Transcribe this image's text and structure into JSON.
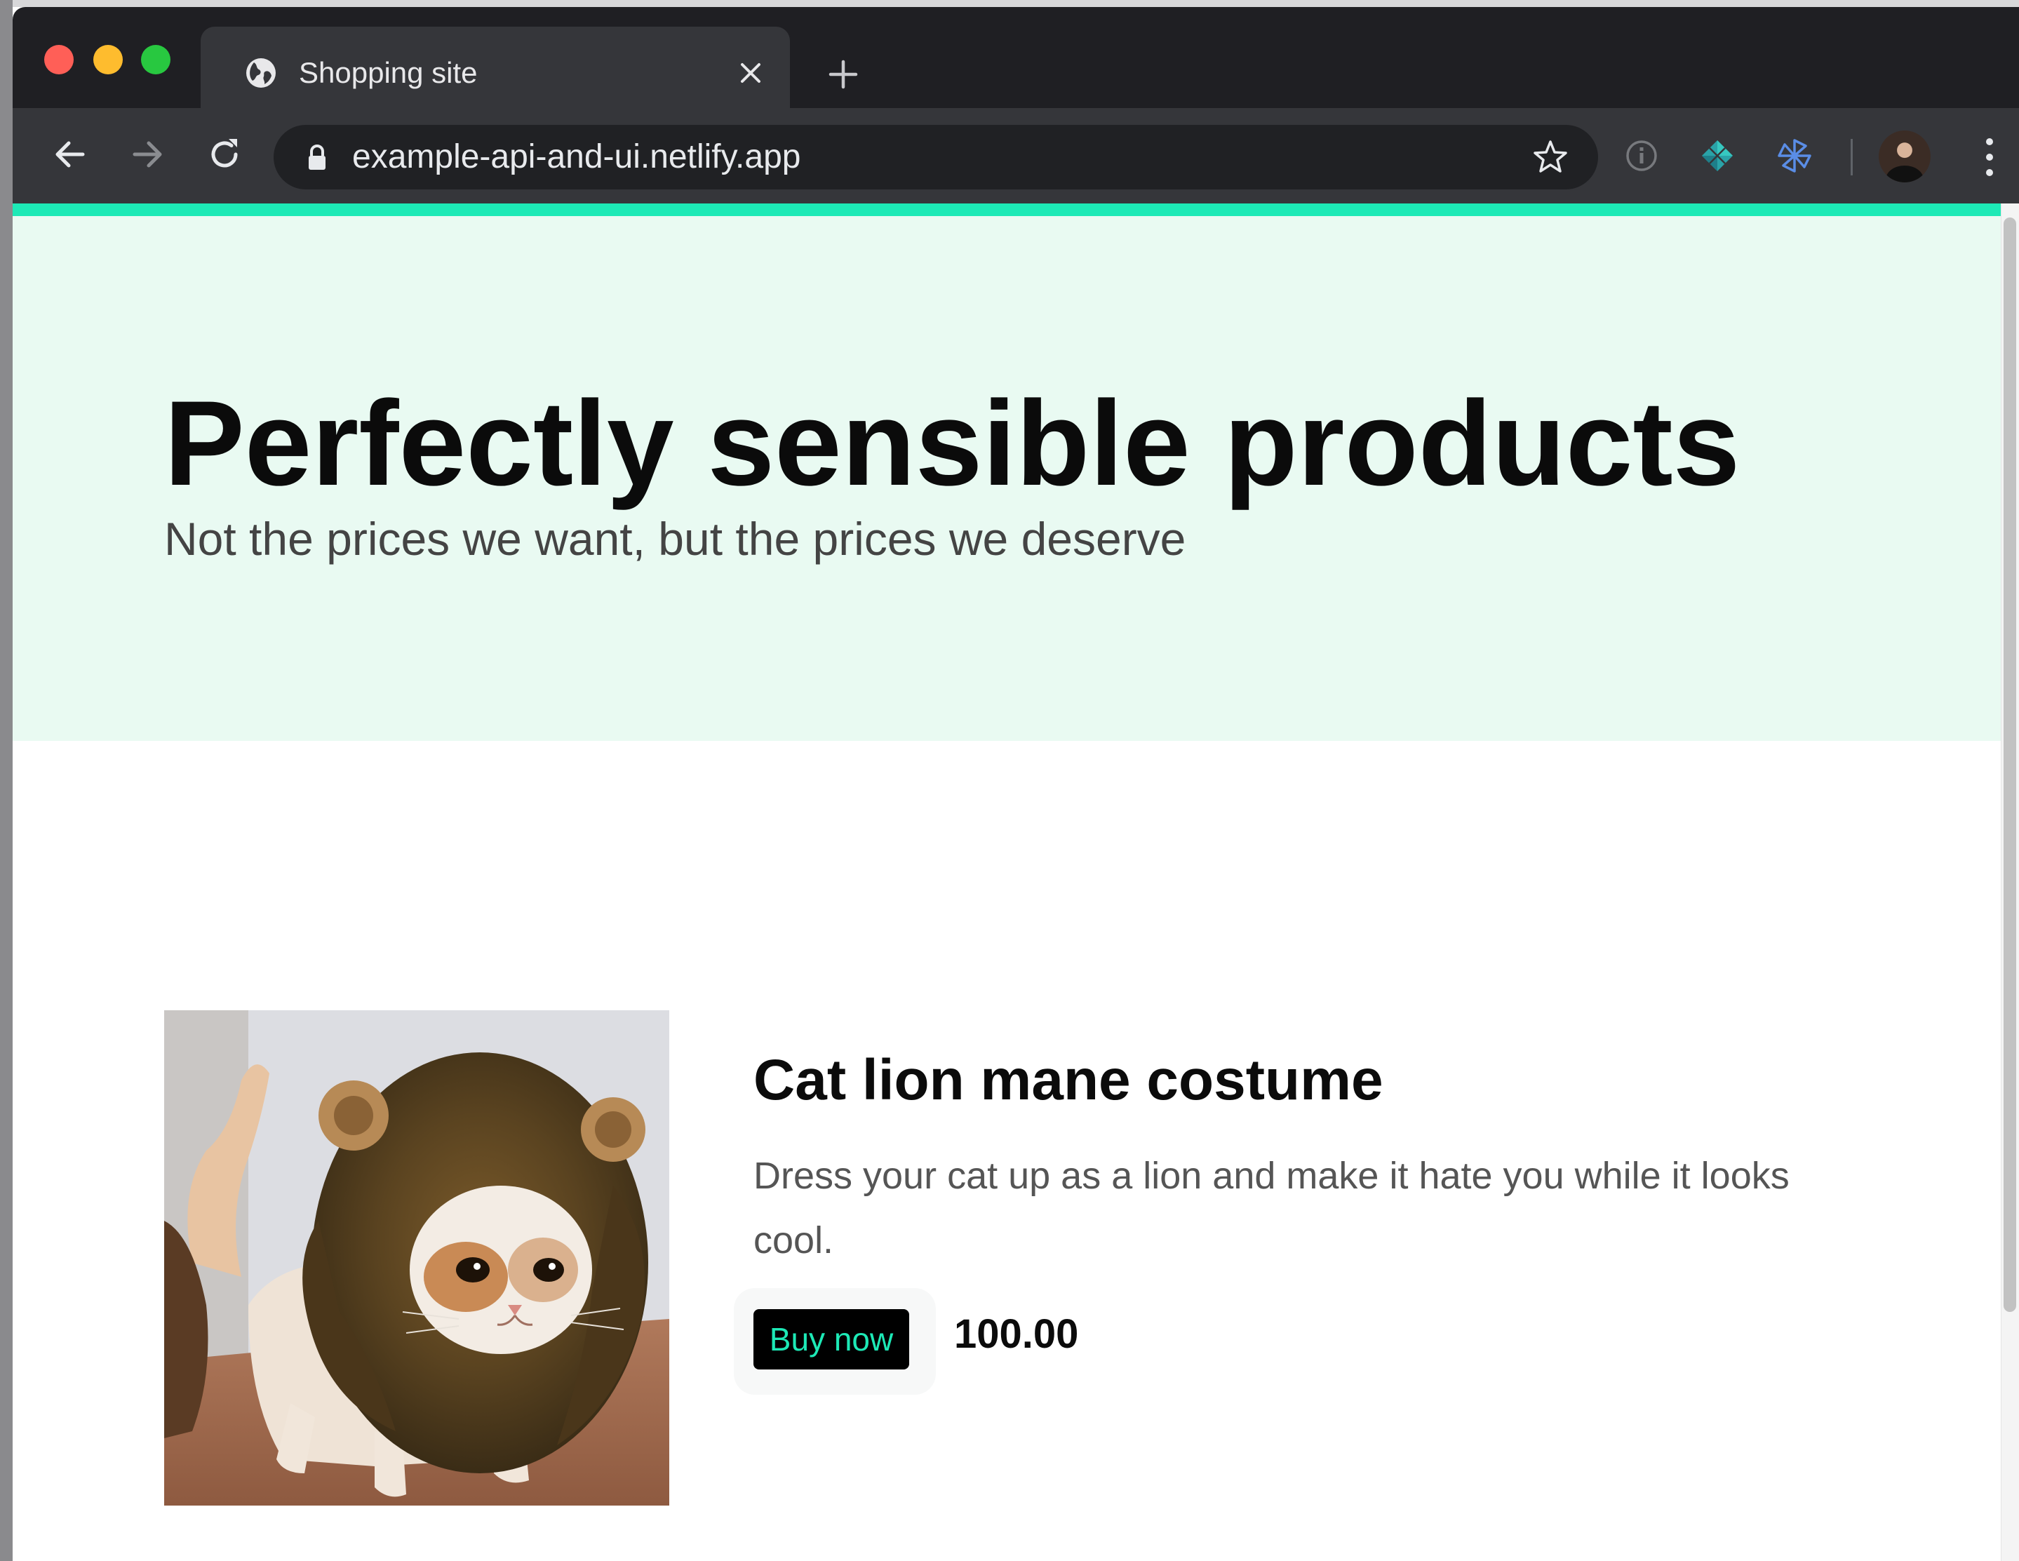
{
  "browser": {
    "tab": {
      "title": "Shopping site",
      "favicon": "globe-icon"
    },
    "address_bar": {
      "url": "example-api-and-ui.netlify.app"
    },
    "icons": {
      "back": "arrow-left-icon",
      "forward": "arrow-right-icon",
      "reload": "reload-icon",
      "lock": "lock-icon",
      "bookmark": "star-icon",
      "menu": "kebab-menu-icon"
    }
  },
  "hero": {
    "title": "Perfectly sensible products",
    "subtitle": "Not the prices we want, but the prices we deserve"
  },
  "products": [
    {
      "name": "Cat lion mane costume",
      "description": "Dress your cat up as a lion and make it hate you while it looks cool.",
      "buy_label": "Buy now",
      "price": "100.00"
    }
  ],
  "colors": {
    "accent": "#1de9b6",
    "hero_background": "#e9faf2",
    "button_background": "#000000"
  }
}
